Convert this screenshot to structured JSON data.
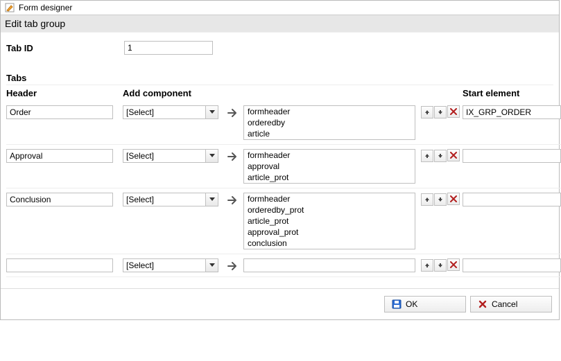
{
  "window": {
    "title": "Form designer"
  },
  "panel": {
    "title": "Edit tab group"
  },
  "tabid": {
    "label": "Tab ID",
    "value": "1"
  },
  "tabs_section_label": "Tabs",
  "columns": {
    "header": "Header",
    "addc": "Add component",
    "start": "Start element"
  },
  "select_placeholder": "[Select]",
  "rows": [
    {
      "header": "Order",
      "addc": "[Select]",
      "list": [
        "formheader",
        "orderedby",
        "article"
      ],
      "start": "IX_GRP_ORDER"
    },
    {
      "header": "Approval",
      "addc": "[Select]",
      "list": [
        "formheader",
        "approval",
        "article_prot"
      ],
      "start": ""
    },
    {
      "header": "Conclusion",
      "addc": "[Select]",
      "list": [
        "formheader",
        "orderedby_prot",
        "article_prot",
        "approval_prot",
        "conclusion"
      ],
      "start": ""
    },
    {
      "header": "",
      "addc": "[Select]",
      "list": [
        ""
      ],
      "start": ""
    }
  ],
  "buttons": {
    "ok": "OK",
    "cancel": "Cancel"
  }
}
